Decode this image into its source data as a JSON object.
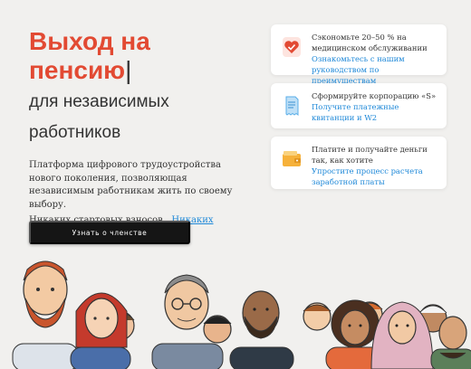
{
  "hero": {
    "title_line1": "Выход на",
    "title_line2": "пенсию",
    "cursor": "|",
    "subtitle_line1": "для независимых",
    "subtitle_line2": "работников",
    "intro": "Платформа цифрового трудоустройства нового поколения, позволяющая независимым работникам жить по своему выбору.",
    "link1": "Никаких стартовых взносов",
    "separator": ".",
    "link2": "Никаких скрытых затрат",
    "end": "."
  },
  "cta": {
    "label": "Узнать о членстве"
  },
  "cards": [
    {
      "icon": "heart-shield-icon",
      "title": "Сэкономьте 20–50 % на медицинском обслуживании",
      "link": "Ознакомьтесь с нашим руководством по преимуществам"
    },
    {
      "icon": "receipt-icon",
      "title": "Сформируйте корпорацию «S»",
      "link": "Получите платежные квитанции и W2"
    },
    {
      "icon": "wallet-icon",
      "title": "Платите и получайте деньги так, как хотите",
      "link": "Упростите процесс расчета заработной платы"
    }
  ],
  "colors": {
    "accent": "#e24a33",
    "link": "#1e88d8",
    "button": "#151515"
  }
}
